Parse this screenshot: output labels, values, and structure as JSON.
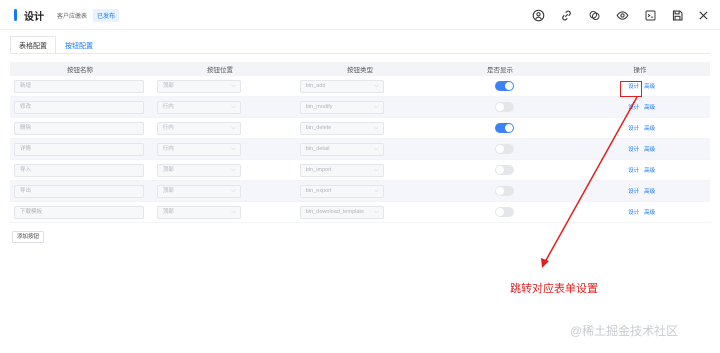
{
  "header": {
    "title": "设计",
    "subtitle": "客户应缴表",
    "status": "已发布",
    "accent_color": "#1677ff",
    "icons": [
      "user-circle-icon",
      "link-icon",
      "copy-icon",
      "eye-icon",
      "terminal-icon",
      "save-icon",
      "close-icon"
    ]
  },
  "tabs": [
    {
      "label": "表格配置",
      "active": false
    },
    {
      "label": "按钮配置",
      "active": true
    }
  ],
  "table": {
    "columns": [
      "按钮名称",
      "按钮位置",
      "按钮类型",
      "是否显示",
      "操作"
    ],
    "rows": [
      {
        "name": "新增",
        "position": "顶部",
        "type": "btn_add",
        "visible": true
      },
      {
        "name": "修改",
        "position": "行内",
        "type": "btn_modify",
        "visible": false
      },
      {
        "name": "删除",
        "position": "行内",
        "type": "btn_delete",
        "visible": true
      },
      {
        "name": "详情",
        "position": "行内",
        "type": "btn_detail",
        "visible": false
      },
      {
        "name": "导入",
        "position": "顶部",
        "type": "btn_import",
        "visible": false
      },
      {
        "name": "导出",
        "position": "顶部",
        "type": "btn_export",
        "visible": false
      },
      {
        "name": "下载模板",
        "position": "顶部",
        "type": "btn_download_template",
        "visible": false
      }
    ],
    "op_design": "设计",
    "op_advanced": "高级"
  },
  "add_button": "添加按钮",
  "annotation": {
    "text": "跳转对应表单设置",
    "color": "#e02020"
  },
  "watermark": "@稀土掘金技术社区"
}
